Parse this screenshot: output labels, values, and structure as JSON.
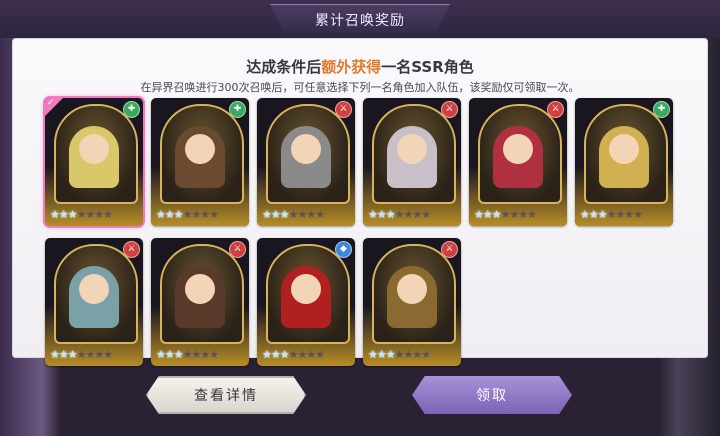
{
  "window": {
    "title": "累计召唤奖励"
  },
  "headline": {
    "prefix": "达成条件后",
    "highlight": "额外获得",
    "suffix": "一名SSR角色"
  },
  "subline": "在异界召唤进行300次召唤后，可任意选择下列一名角色加入队伍，该奖励仅可领取一次。",
  "cards": [
    {
      "icon": "class-icon-green",
      "selected": true,
      "stars": 3
    },
    {
      "icon": "class-icon-green",
      "selected": false,
      "stars": 3
    },
    {
      "icon": "class-icon-red",
      "selected": false,
      "stars": 3
    },
    {
      "icon": "class-icon-red",
      "selected": false,
      "stars": 3
    },
    {
      "icon": "class-icon-red",
      "selected": false,
      "stars": 3
    },
    {
      "icon": "class-icon-green",
      "selected": false,
      "stars": 3
    },
    {
      "icon": "class-icon-red",
      "selected": false,
      "stars": 3
    },
    {
      "icon": "class-icon-red",
      "selected": false,
      "stars": 3
    },
    {
      "icon": "class-icon-blue",
      "selected": false,
      "stars": 3
    },
    {
      "icon": "class-icon-red",
      "selected": false,
      "stars": 3
    }
  ],
  "buttons": {
    "detail": "查看详情",
    "claim": "领取"
  },
  "colors": {
    "accent": "#e07b2e",
    "claim": "#8a73c4",
    "select": "#f07bc0"
  }
}
